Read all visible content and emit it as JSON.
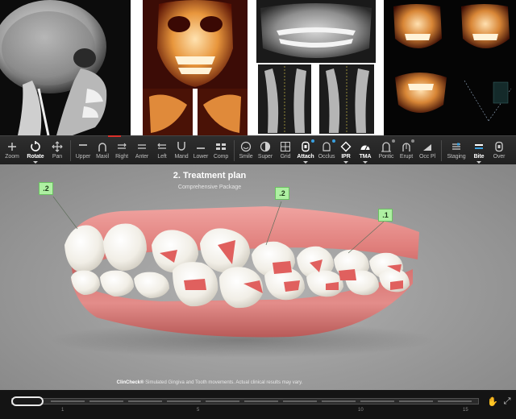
{
  "toolbar": {
    "tools": [
      {
        "label": "Zoom",
        "icon": "zoom-icon"
      },
      {
        "label": "Rotate",
        "icon": "rotate-icon",
        "active": true
      },
      {
        "label": "Pan",
        "icon": "pan-icon"
      },
      {
        "label": "Upper",
        "icon": "upper-jaw-icon"
      },
      {
        "label": "Maxil",
        "icon": "maxillary-icon"
      },
      {
        "label": "Right",
        "icon": "right-view-icon"
      },
      {
        "label": "Anter",
        "icon": "anterior-view-icon"
      },
      {
        "label": "Left",
        "icon": "left-view-icon"
      },
      {
        "label": "Mand",
        "icon": "mandibular-icon"
      },
      {
        "label": "Lower",
        "icon": "lower-jaw-icon"
      },
      {
        "label": "Comp",
        "icon": "compare-icon"
      },
      {
        "label": "Smile",
        "icon": "smile-icon"
      },
      {
        "label": "Super",
        "icon": "superimpose-icon"
      },
      {
        "label": "Grid",
        "icon": "grid-icon"
      },
      {
        "label": "Attach",
        "icon": "attachment-icon",
        "active": true
      },
      {
        "label": "Occlus",
        "icon": "occlusion-icon"
      },
      {
        "label": "IPR",
        "icon": "ipr-icon",
        "active": true
      },
      {
        "label": "TMA",
        "icon": "tma-icon",
        "active": true
      },
      {
        "label": "Pontic",
        "icon": "pontic-icon"
      },
      {
        "label": "Erupt",
        "icon": "eruption-icon"
      },
      {
        "label": "Occ Pl",
        "icon": "occlusal-plane-icon"
      },
      {
        "label": "Staging",
        "icon": "staging-icon"
      },
      {
        "label": "Bite",
        "icon": "bite-icon",
        "active": true
      },
      {
        "label": "Over",
        "icon": "overlay-icon"
      }
    ]
  },
  "viewer": {
    "title": "2. Treatment plan",
    "subtitle": "Comprehensive Package",
    "tags": [
      ".2",
      ".2",
      ".1"
    ],
    "disclaimer_brand": "ClinCheck®",
    "disclaimer_text": " Simulated Gingiva and Tooth movements. Actual clinical results may vary."
  },
  "timeline": {
    "numbers": [
      "1",
      "5",
      "10",
      "15"
    ]
  },
  "colors": {
    "gingiva": "#e07f7c",
    "tooth": "#f4f1ea",
    "attachment": "#e0605e",
    "tag_bg": "#aef0a2",
    "viewer_bg": "#9c9c9c"
  }
}
